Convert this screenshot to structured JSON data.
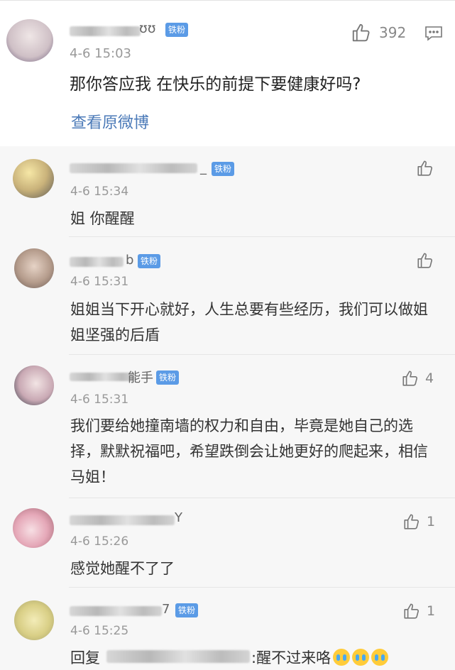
{
  "main": {
    "name_suffix": "ʊʊ",
    "badge": "铁粉",
    "time": "4-6 15:03",
    "like_count": "392",
    "text": "那你答应我 在快乐的前提下要健康好吗?",
    "view_original": "查看原微博"
  },
  "replies": [
    {
      "name_suffix": "_",
      "badge": "铁粉",
      "time": "4-6 15:34",
      "text": "姐 你醒醒",
      "like_count": ""
    },
    {
      "name_suffix": "b",
      "badge": "铁粉",
      "time": "4-6 15:31",
      "text": "姐姐当下开心就好，人生总要有些经历，我们可以做姐姐坚强的后盾",
      "like_count": ""
    },
    {
      "name_suffix": "能手",
      "badge": "铁粉",
      "time": "4-6 15:31",
      "text": "我们要给她撞南墙的权力和自由，毕竟是她自己的选择，默默祝福吧，希望跌倒会让她更好的爬起来，相信马姐！",
      "like_count": "4"
    },
    {
      "name_suffix": "Y",
      "badge": "",
      "time": "4-6 15:26",
      "text": "感觉她醒不了了",
      "like_count": "1"
    },
    {
      "name_suffix": "7",
      "badge": "铁粉",
      "time": "4-6 15:25",
      "text_prefix": "回复",
      "text": ":醒不过来咯",
      "like_count": "1"
    }
  ],
  "colors": {
    "badge": "#5b9be6",
    "link": "#4b7ab8",
    "time": "#999999"
  },
  "icons": [
    "thumbs-up-icon",
    "comment-icon",
    "crying-emoji"
  ]
}
